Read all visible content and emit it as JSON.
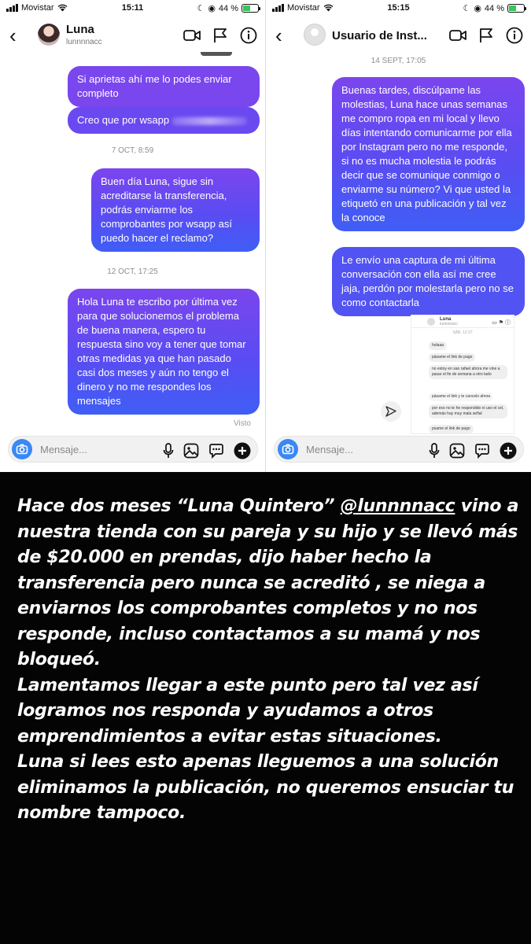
{
  "left": {
    "status": {
      "carrier": "Movistar",
      "time": "15:11",
      "battery": "44 %"
    },
    "header": {
      "name": "Luna",
      "username": "lunnnnacc"
    },
    "messages": [
      {
        "text": "Si aprietas ahí me lo podes enviar completo"
      },
      {
        "text": "Creo que por wsapp"
      },
      {
        "text": "Buen día Luna, sigue sin acreditarse la transferencia, podrás enviarme los comprobantes por wsapp así puedo hacer el reclamo?"
      },
      {
        "text": "Hola Luna te escribo por última vez para que solucionemos el problema de buena manera, espero tu respuesta sino voy a tener que tomar otras medidas ya que han pasado casi dos meses y aún no tengo el dinero y no me respondes los mensajes"
      }
    ],
    "timestamps": [
      "7 OCT, 8:59",
      "12 OCT, 17:25"
    ],
    "seen": "Visto",
    "composer": {
      "placeholder": "Mensaje..."
    }
  },
  "right": {
    "status": {
      "carrier": "Movistar",
      "time": "15:15",
      "battery": "44 %"
    },
    "header": {
      "name": "Usuario de Inst..."
    },
    "timestamp": "14 SEPT, 17:05",
    "messages": [
      {
        "text": "Buenas tardes, discúlpame las molestias, Luna hace unas semanas me compro ropa en mi local y llevo días intentando comunicarme por ella por Instagram pero no me responde, si no es mucha molestia le podrás decir que se comunique conmigo o enviarme su número? Vi que usted la etiquetó en una publicación y tal vez la conoce"
      },
      {
        "text": "Le envío una captura de mi última conversación con ella así me cree jaja, perdón por molestarla pero no se como contactarla"
      }
    ],
    "screenshot": {
      "name": "Luna",
      "username": "lunnnnacc",
      "timestamp": "SÁB. 12:27",
      "bubbles": [
        "holaaa",
        "pásame el link de pago",
        "no estoy en san rafael ahora me vine a pasar el fin de semana a otro lado",
        "pásame el link y te cancelo ahora",
        "por eso no te he respondido ni uso el cel, además hay muy mala señal",
        "psame el link de pago"
      ]
    },
    "composer": {
      "placeholder": "Mensaje..."
    }
  },
  "story": {
    "p1_a": "Hace dos meses “Luna Quintero” ",
    "p1_handle": "@lunnnnacc",
    "p1_b": " vino a nuestra tienda con su pareja y su hijo y se llevó más de $20.000 en prendas, dijo haber hecho la transferencia pero nunca se acreditó , se niega a enviarnos los comprobantes completos y no nos responde, incluso contactamos a su mamá y nos bloqueó.",
    "p2": "Lamentamos llegar a este punto pero tal vez así logramos nos responda y ayudamos a otros emprendimientos a evitar estas situaciones.",
    "p3": "Luna si lees esto apenas lleguemos a una solución eliminamos la publicación, no queremos ensuciar tu nombre tampoco."
  },
  "colors": {
    "bubble_purple": "#7b45ee",
    "bubble_blue": "#3f5ef5",
    "camera_blue": "#3a88f5",
    "story_bg": "#040404"
  },
  "icons": [
    "back-chevron-icon",
    "video-icon",
    "flag-icon",
    "info-icon",
    "camera-icon",
    "microphone-icon",
    "gallery-icon",
    "sticker-icon",
    "add-icon",
    "send-icon"
  ]
}
